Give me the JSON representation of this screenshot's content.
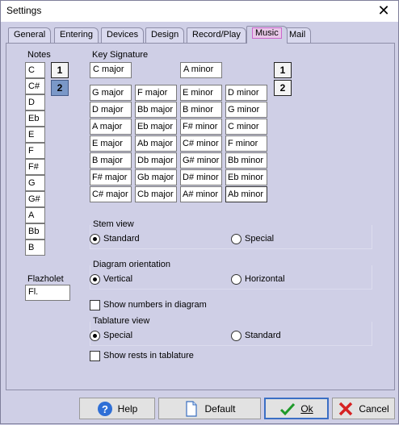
{
  "window": {
    "title": "Settings",
    "close_glyph": "✕"
  },
  "tabs": [
    {
      "label": "General"
    },
    {
      "label": "Entering"
    },
    {
      "label": "Devices"
    },
    {
      "label": "Design"
    },
    {
      "label": "Record/Play"
    },
    {
      "label": "Music"
    },
    {
      "label": "Mail"
    }
  ],
  "notes": {
    "label": "Notes",
    "items": [
      "C",
      "C#",
      "D",
      "Eb",
      "E",
      "F",
      "F#",
      "G",
      "G#",
      "A",
      "Bb",
      "B"
    ],
    "page_buttons": [
      "1",
      "2"
    ],
    "active_page": "2"
  },
  "key_signature": {
    "label": "Key Signature",
    "current_major": "C major",
    "current_minor": "A minor",
    "page_buttons": [
      "1",
      "2"
    ],
    "grid": [
      [
        "G major",
        "F major",
        "E minor",
        "D minor"
      ],
      [
        "D major",
        "Bb major",
        "B minor",
        "G minor"
      ],
      [
        "A major",
        "Eb major",
        "F# minor",
        "C minor"
      ],
      [
        "E major",
        "Ab major",
        "C# minor",
        "F minor"
      ],
      [
        "B major",
        "Db major",
        "G# minor",
        "Bb minor"
      ],
      [
        "F# major",
        "Gb major",
        "D# minor",
        "Eb minor"
      ],
      [
        "C# major",
        "Cb major",
        "A# minor",
        "Ab minor"
      ]
    ]
  },
  "stem_view": {
    "label": "Stem view",
    "options": [
      "Standard",
      "Special"
    ],
    "selected": "Standard"
  },
  "diagram_orientation": {
    "label": "Diagram orientation",
    "options": [
      "Vertical",
      "Horizontal"
    ],
    "selected": "Vertical"
  },
  "show_numbers": {
    "label": "Show numbers in diagram",
    "checked": false
  },
  "tablature_view": {
    "label": "Tablature view",
    "options": [
      "Special",
      "Standard"
    ],
    "selected": "Special"
  },
  "show_rests": {
    "label": "Show rests in tablature",
    "checked": false
  },
  "flazholet": {
    "label": "Flazholet",
    "value": "Fl."
  },
  "buttons": {
    "help": "Help",
    "default": "Default",
    "ok": "Ok",
    "cancel": "Cancel"
  }
}
